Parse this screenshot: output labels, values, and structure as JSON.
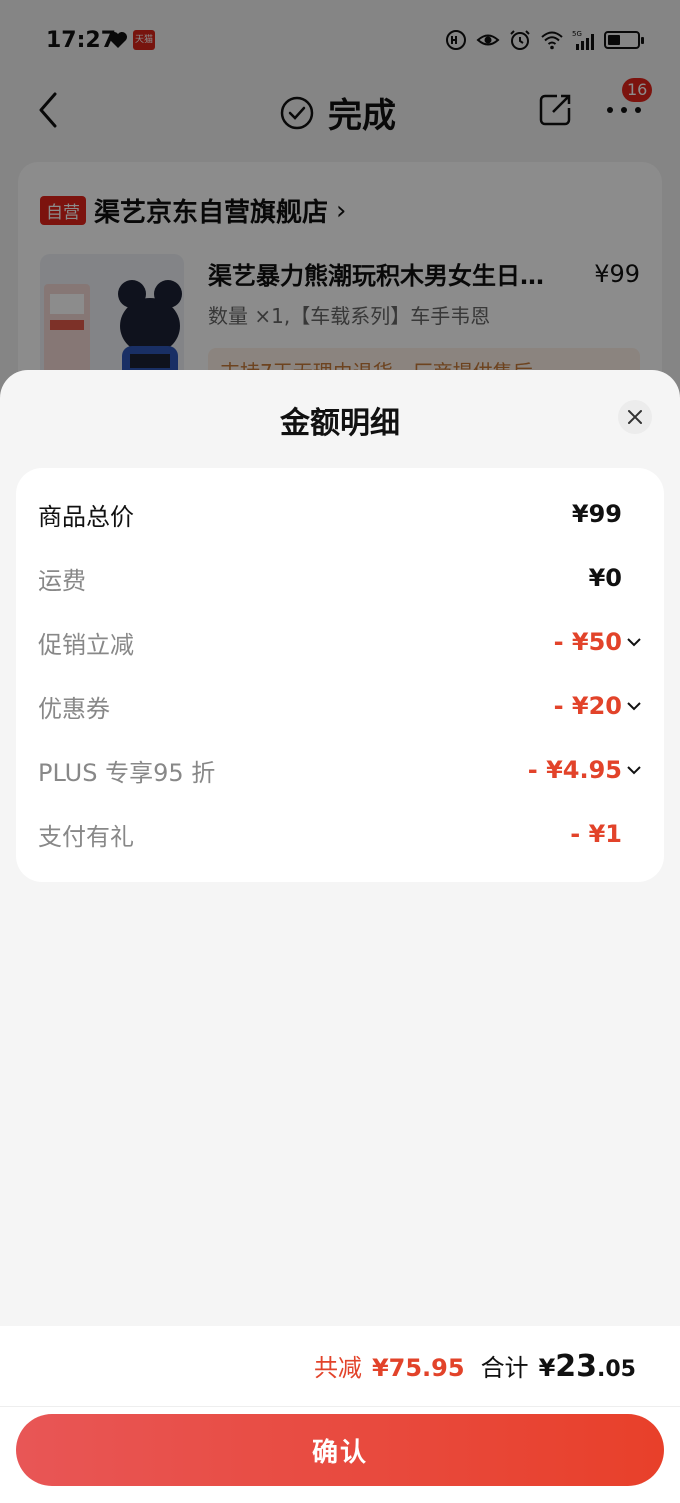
{
  "status_bar": {
    "time": "17:27",
    "tmall_label": "天猫",
    "icons": [
      "heart-icon",
      "tmall-icon",
      "hd-icon",
      "eye-icon",
      "alarm-icon",
      "wifi-icon",
      "signal-5g-icon",
      "battery-icon"
    ]
  },
  "nav": {
    "title": "完成",
    "badge_count": "16",
    "icons": [
      "back-icon",
      "check-circle-icon",
      "share-icon",
      "more-icon"
    ]
  },
  "store": {
    "tag": "自营",
    "name": "渠艺京东自营旗舰店",
    "arrow": "›",
    "product_title": "渠艺暴力熊潮玩积木男女生日…",
    "product_price": "¥99",
    "product_spec": "数量 ×1,【车载系列】车手韦恩",
    "service_text": "支持7天无理由退货，厂商提供售后"
  },
  "sheet": {
    "title": "金额明细",
    "rows": [
      {
        "label": "商品总价",
        "value": "¥99",
        "style": "strong"
      },
      {
        "label": "运费",
        "value": "¥0",
        "style": "normal"
      },
      {
        "label": "促销立减",
        "value": "- ¥50",
        "style": "discount",
        "expandable": true
      },
      {
        "label": "优惠券",
        "value": "- ¥20",
        "style": "discount",
        "expandable": true
      },
      {
        "label": "PLUS 专享95 折",
        "value": "- ¥4.95",
        "style": "discount",
        "expandable": true
      },
      {
        "label": "支付有礼",
        "value": "- ¥1",
        "style": "discount",
        "expandable": false
      }
    ]
  },
  "summary": {
    "reduce_label": "共减",
    "reduce_value": "¥75.95",
    "total_label": "合计",
    "total_currency": "¥",
    "total_int": "23",
    "total_dec": ".05",
    "confirm_label": "确认"
  },
  "colors": {
    "accent_red": "#e2432a",
    "brand_red": "#e2231a",
    "button_gradient_start": "#e85656",
    "button_gradient_end": "#e8402a"
  }
}
